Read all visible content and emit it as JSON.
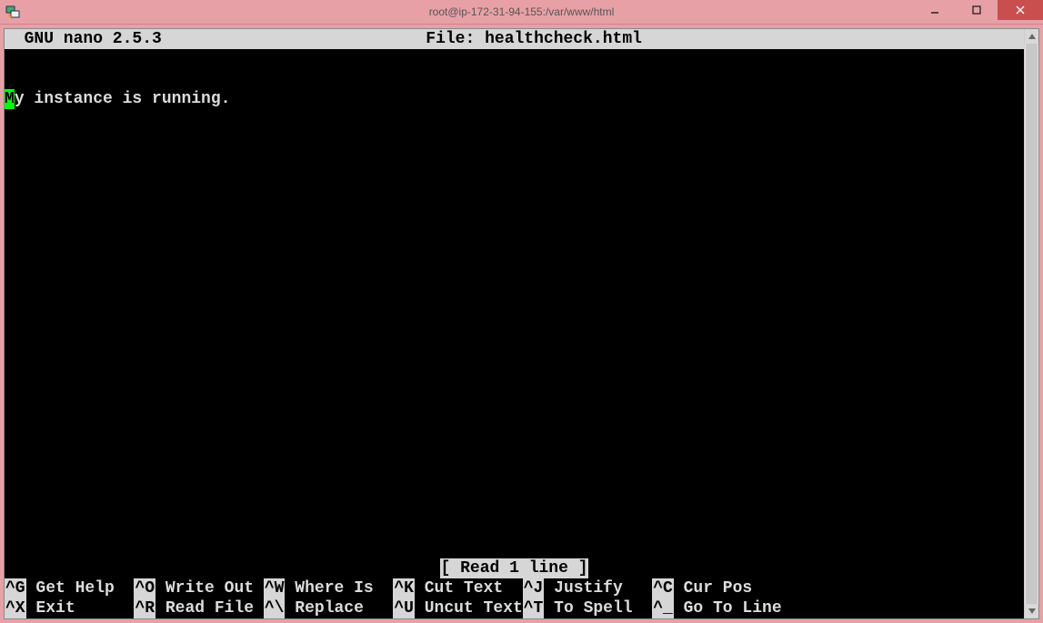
{
  "window": {
    "title": "root@ip-172-31-94-155:/var/www/html"
  },
  "nano": {
    "app_label": "GNU nano 2.5.3",
    "file_label": "File: healthcheck.html",
    "cursor_char": "M",
    "content_rest": "y instance is running.",
    "status": "[ Read 1 line ]"
  },
  "shortcuts": {
    "row1": [
      {
        "key": "^G",
        "label": " Get Help  "
      },
      {
        "key": "^O",
        "label": " Write Out "
      },
      {
        "key": "^W",
        "label": " Where Is  "
      },
      {
        "key": "^K",
        "label": " Cut Text  "
      },
      {
        "key": "^J",
        "label": " Justify   "
      },
      {
        "key": "^C",
        "label": " Cur Pos"
      }
    ],
    "row2": [
      {
        "key": "^X",
        "label": " Exit      "
      },
      {
        "key": "^R",
        "label": " Read File "
      },
      {
        "key": "^\\",
        "label": " Replace   "
      },
      {
        "key": "^U",
        "label": " Uncut Text"
      },
      {
        "key": "^T",
        "label": " To Spell  "
      },
      {
        "key": "^_",
        "label": " Go To Line"
      }
    ]
  }
}
